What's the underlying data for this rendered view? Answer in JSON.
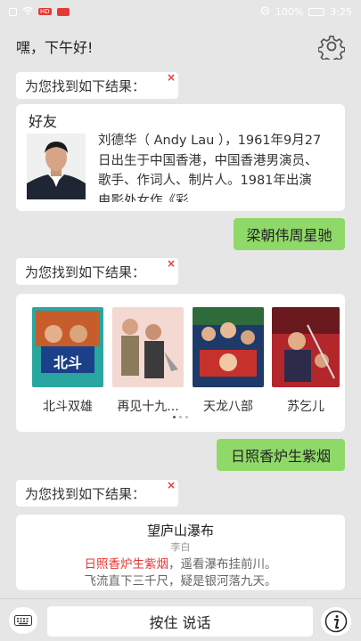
{
  "status_bar": {
    "badge": "HD",
    "battery": "100%",
    "time": "3:25"
  },
  "header": {
    "greeting": "嘿，下午好!"
  },
  "found_label": "为您找到如下结果：",
  "close_glyph": "×",
  "friend_card": {
    "title": "好友",
    "description": "刘德华（ Andy Lau ），1961年9月27日出生于中国香港，中国香港男演员、歌手、作词人、制片人。1981年出演电影处女作《彩"
  },
  "user_messages": [
    "梁朝伟周星驰",
    "日照香炉生紫烟"
  ],
  "movies": [
    {
      "title": "北斗双雄"
    },
    {
      "title": "再见十九..."
    },
    {
      "title": "天龙八部"
    },
    {
      "title": "苏乞儿"
    }
  ],
  "poem": {
    "title": "望庐山瀑布",
    "author": "李白",
    "line1_highlight": "日照香炉生紫烟",
    "line1_rest": "，遥看瀑布挂前川。",
    "line2": "飞流直下三千尺，疑是银河落九天。"
  },
  "bottom_bar": {
    "talk_label": "按住 说话"
  },
  "colors": {
    "accent_green": "#8fd968",
    "highlight_red": "#e53935",
    "background": "#e6e6e6"
  }
}
